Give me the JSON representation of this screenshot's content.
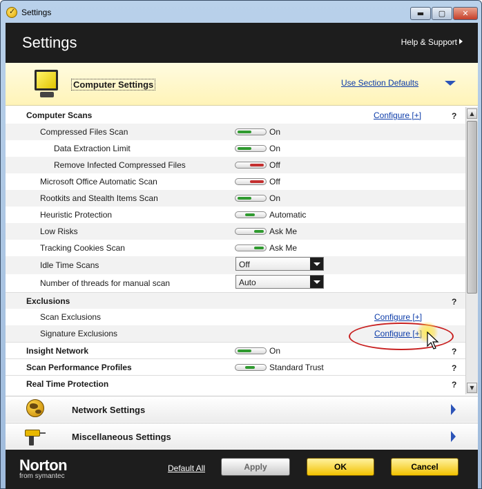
{
  "window": {
    "title": "Settings",
    "minimize_glyph": "▬",
    "maximize_glyph": "▢",
    "close_glyph": "✕"
  },
  "header": {
    "title": "Settings",
    "help_link": "Help & Support"
  },
  "section": {
    "title": "Computer Settings",
    "defaults_link": "Use Section Defaults",
    "icon": "monitor-icon"
  },
  "rows": {
    "computer_scans": {
      "label": "Computer Scans",
      "configure": "Configure [+]",
      "help": "?"
    },
    "compressed_files_scan": {
      "label": "Compressed Files Scan",
      "value": "On",
      "state": "on"
    },
    "data_extraction_limit": {
      "label": "Data Extraction Limit",
      "value": "On",
      "state": "on"
    },
    "remove_infected_compressed": {
      "label": "Remove Infected Compressed Files",
      "value": "Off",
      "state": "off"
    },
    "ms_office_scan": {
      "label": "Microsoft Office Automatic Scan",
      "value": "Off",
      "state": "off"
    },
    "rootkits_scan": {
      "label": "Rootkits and Stealth Items Scan",
      "value": "On",
      "state": "on"
    },
    "heuristic_protection": {
      "label": "Heuristic Protection",
      "value": "Automatic",
      "state": "mid"
    },
    "low_risks": {
      "label": "Low Risks",
      "value": "Ask Me",
      "state": "ask"
    },
    "tracking_cookies": {
      "label": "Tracking Cookies Scan",
      "value": "Ask Me",
      "state": "ask"
    },
    "idle_time_scans": {
      "label": "Idle Time Scans",
      "selected": "Off"
    },
    "threads_manual_scan": {
      "label": "Number of threads for manual scan",
      "selected": "Auto"
    },
    "exclusions": {
      "label": "Exclusions",
      "help": "?"
    },
    "scan_exclusions": {
      "label": "Scan Exclusions",
      "configure": "Configure [+]"
    },
    "signature_exclusions": {
      "label": "Signature Exclusions",
      "configure": "Configure [+]"
    },
    "insight_network": {
      "label": "Insight Network",
      "value": "On",
      "state": "on",
      "help": "?"
    },
    "scan_performance": {
      "label": "Scan Performance Profiles",
      "value": "Standard Trust",
      "state": "mid",
      "help": "?"
    },
    "real_time_protection": {
      "label": "Real Time Protection",
      "help": "?"
    }
  },
  "scrollbar": {
    "up_glyph": "▲",
    "down_glyph": "▼"
  },
  "collapsed_sections": [
    {
      "title": "Network Settings",
      "icon": "globe-icon"
    },
    {
      "title": "Miscellaneous Settings",
      "icon": "drill-icon"
    }
  ],
  "footer": {
    "brand": "Norton",
    "brand_sub": "from symantec",
    "default_all": "Default All",
    "apply": "Apply",
    "ok": "OK",
    "cancel": "Cancel"
  },
  "colors": {
    "header_bg": "#1d1d1d",
    "section_bg": "#fff4b8",
    "link": "#0a3aa8",
    "on": "#2f9a2f",
    "off": "#c43030",
    "button_yellow": "#f2c200",
    "highlight_ring": "#c82020"
  }
}
